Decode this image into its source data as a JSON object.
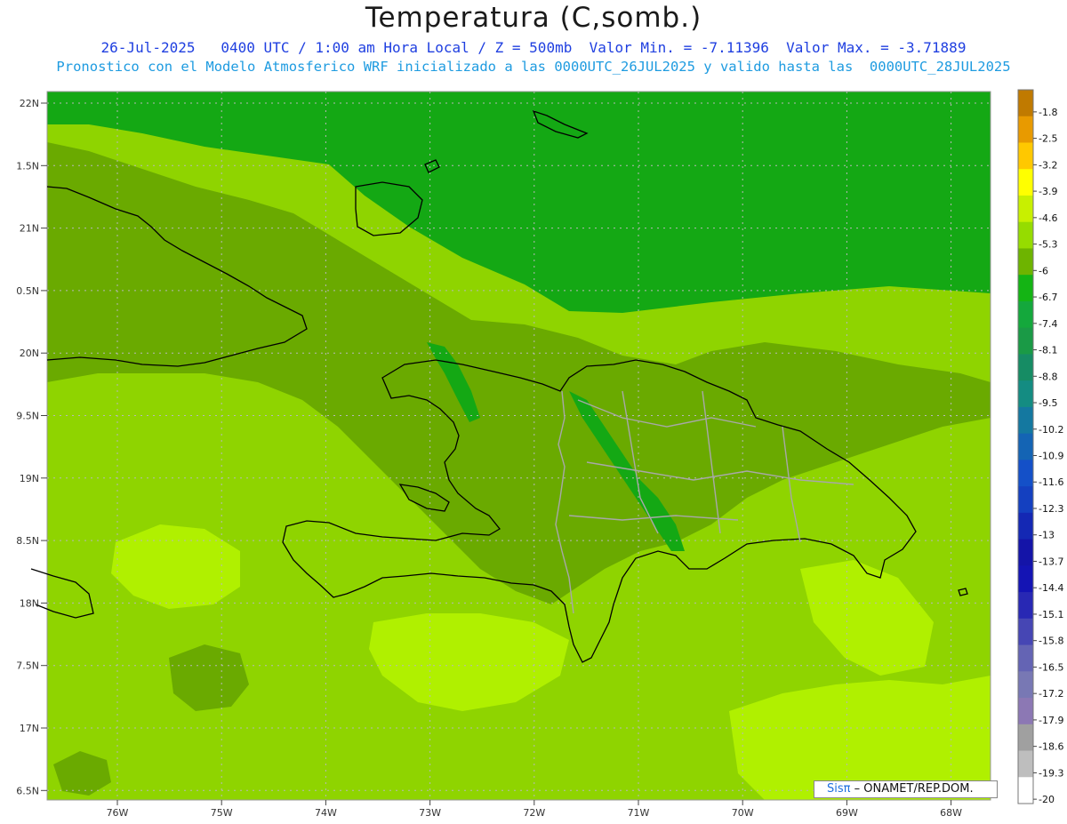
{
  "header": {
    "title": "Temperatura (C,somb.)",
    "line1": "26-Jul-2025   0400 UTC / 1:00 am Hora Local / Z = 500mb  Valor Min. = -7.11396  Valor Max. = -3.71889",
    "line2": "Pronostico con el Modelo Atmosferico WRF inicializado a las 0000UTC_26JUL2025 y valido hasta las  0000UTC_28JUL2025"
  },
  "lat_ticks": [
    "22N",
    "1.5N",
    "21N",
    "0.5N",
    "20N",
    "9.5N",
    "19N",
    "8.5N",
    "18N",
    "7.5N",
    "17N",
    "6.5N"
  ],
  "lon_ticks": [
    "76W",
    "75W",
    "74W",
    "73W",
    "72W",
    "71W",
    "70W",
    "69W",
    "68W"
  ],
  "colorbar": {
    "labels": [
      "-1.8",
      "-2.5",
      "-3.2",
      "-3.9",
      "-4.6",
      "-5.3",
      "-6",
      "-6.7",
      "-7.4",
      "-8.1",
      "-8.8",
      "-9.5",
      "-10.2",
      "-10.9",
      "-11.6",
      "-12.3",
      "-13",
      "-13.7",
      "-14.4",
      "-15.1",
      "-15.8",
      "-16.5",
      "-17.2",
      "-17.9",
      "-18.6",
      "-19.3",
      "-20"
    ],
    "colors": [
      "#c07a00",
      "#e89a00",
      "#ffc800",
      "#ffff00",
      "#c8f000",
      "#96dc00",
      "#6eb400",
      "#14b414",
      "#14a83c",
      "#1a9a46",
      "#168c64",
      "#148c82",
      "#1478a0",
      "#1464b4",
      "#1450c8",
      "#1440c0",
      "#1428b4",
      "#1414a8",
      "#1414b4",
      "#2828b4",
      "#4646b4",
      "#6464b4",
      "#7878b4",
      "#8c78b4",
      "#a0a0a0",
      "#bebebe",
      "#ffffff"
    ]
  },
  "map_colors": {
    "sea_base": "#8fd400",
    "warm": "#b0f000",
    "cool": "#6aaa00",
    "cold": "#14a814",
    "coast": "#000000",
    "province": "#a8a8a8"
  },
  "credit": {
    "brand": "Sisπ",
    "text": "– ONAMET/REP.DOM."
  }
}
